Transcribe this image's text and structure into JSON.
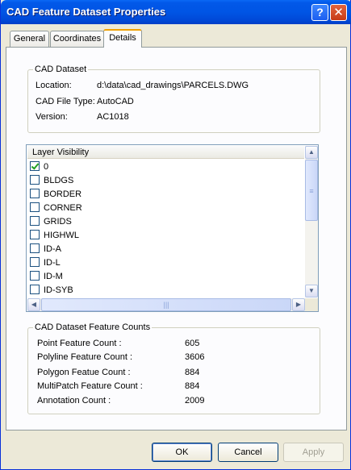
{
  "window": {
    "title": "CAD Feature Dataset Properties",
    "help_glyph": "?",
    "close_glyph": "✕"
  },
  "tabs": [
    {
      "label": "General"
    },
    {
      "label": "Coordinates"
    },
    {
      "label": "Details",
      "active": true
    }
  ],
  "cad_dataset": {
    "legend": "CAD Dataset",
    "rows": [
      {
        "label": "Location:",
        "value": "d:\\data\\cad_drawings\\PARCELS.DWG"
      },
      {
        "label": "CAD File Type:",
        "value": "AutoCAD"
      },
      {
        "label": "Version:",
        "value": "AC1018"
      }
    ]
  },
  "layer_visibility": {
    "header": "Layer Visibility",
    "items": [
      {
        "name": "0",
        "checked": true
      },
      {
        "name": "BLDGS",
        "checked": false
      },
      {
        "name": "BORDER",
        "checked": false
      },
      {
        "name": "CORNER",
        "checked": false
      },
      {
        "name": "GRIDS",
        "checked": false
      },
      {
        "name": "HIGHWL",
        "checked": false
      },
      {
        "name": "ID-A",
        "checked": false
      },
      {
        "name": "ID-L",
        "checked": false
      },
      {
        "name": "ID-M",
        "checked": false
      },
      {
        "name": "ID-SYB",
        "checked": false
      }
    ]
  },
  "feature_counts": {
    "legend": "CAD Dataset Feature Counts",
    "rows": [
      {
        "label": "Point Feature Count :",
        "value": "605"
      },
      {
        "label": "Polyline Feature Count :",
        "value": "3606"
      },
      {
        "label": "Polygon Featue Count :",
        "value": "884"
      },
      {
        "label": "MultiPatch Feature Count :",
        "value": "884"
      },
      {
        "label": "Annotation Count :",
        "value": "2009"
      }
    ]
  },
  "buttons": {
    "ok": "OK",
    "cancel": "Cancel",
    "apply": "Apply"
  },
  "scroll_glyphs": {
    "up": "▲",
    "down": "▼",
    "left": "◀",
    "right": "▶",
    "v_grip": "≡",
    "h_grip": "|||"
  }
}
